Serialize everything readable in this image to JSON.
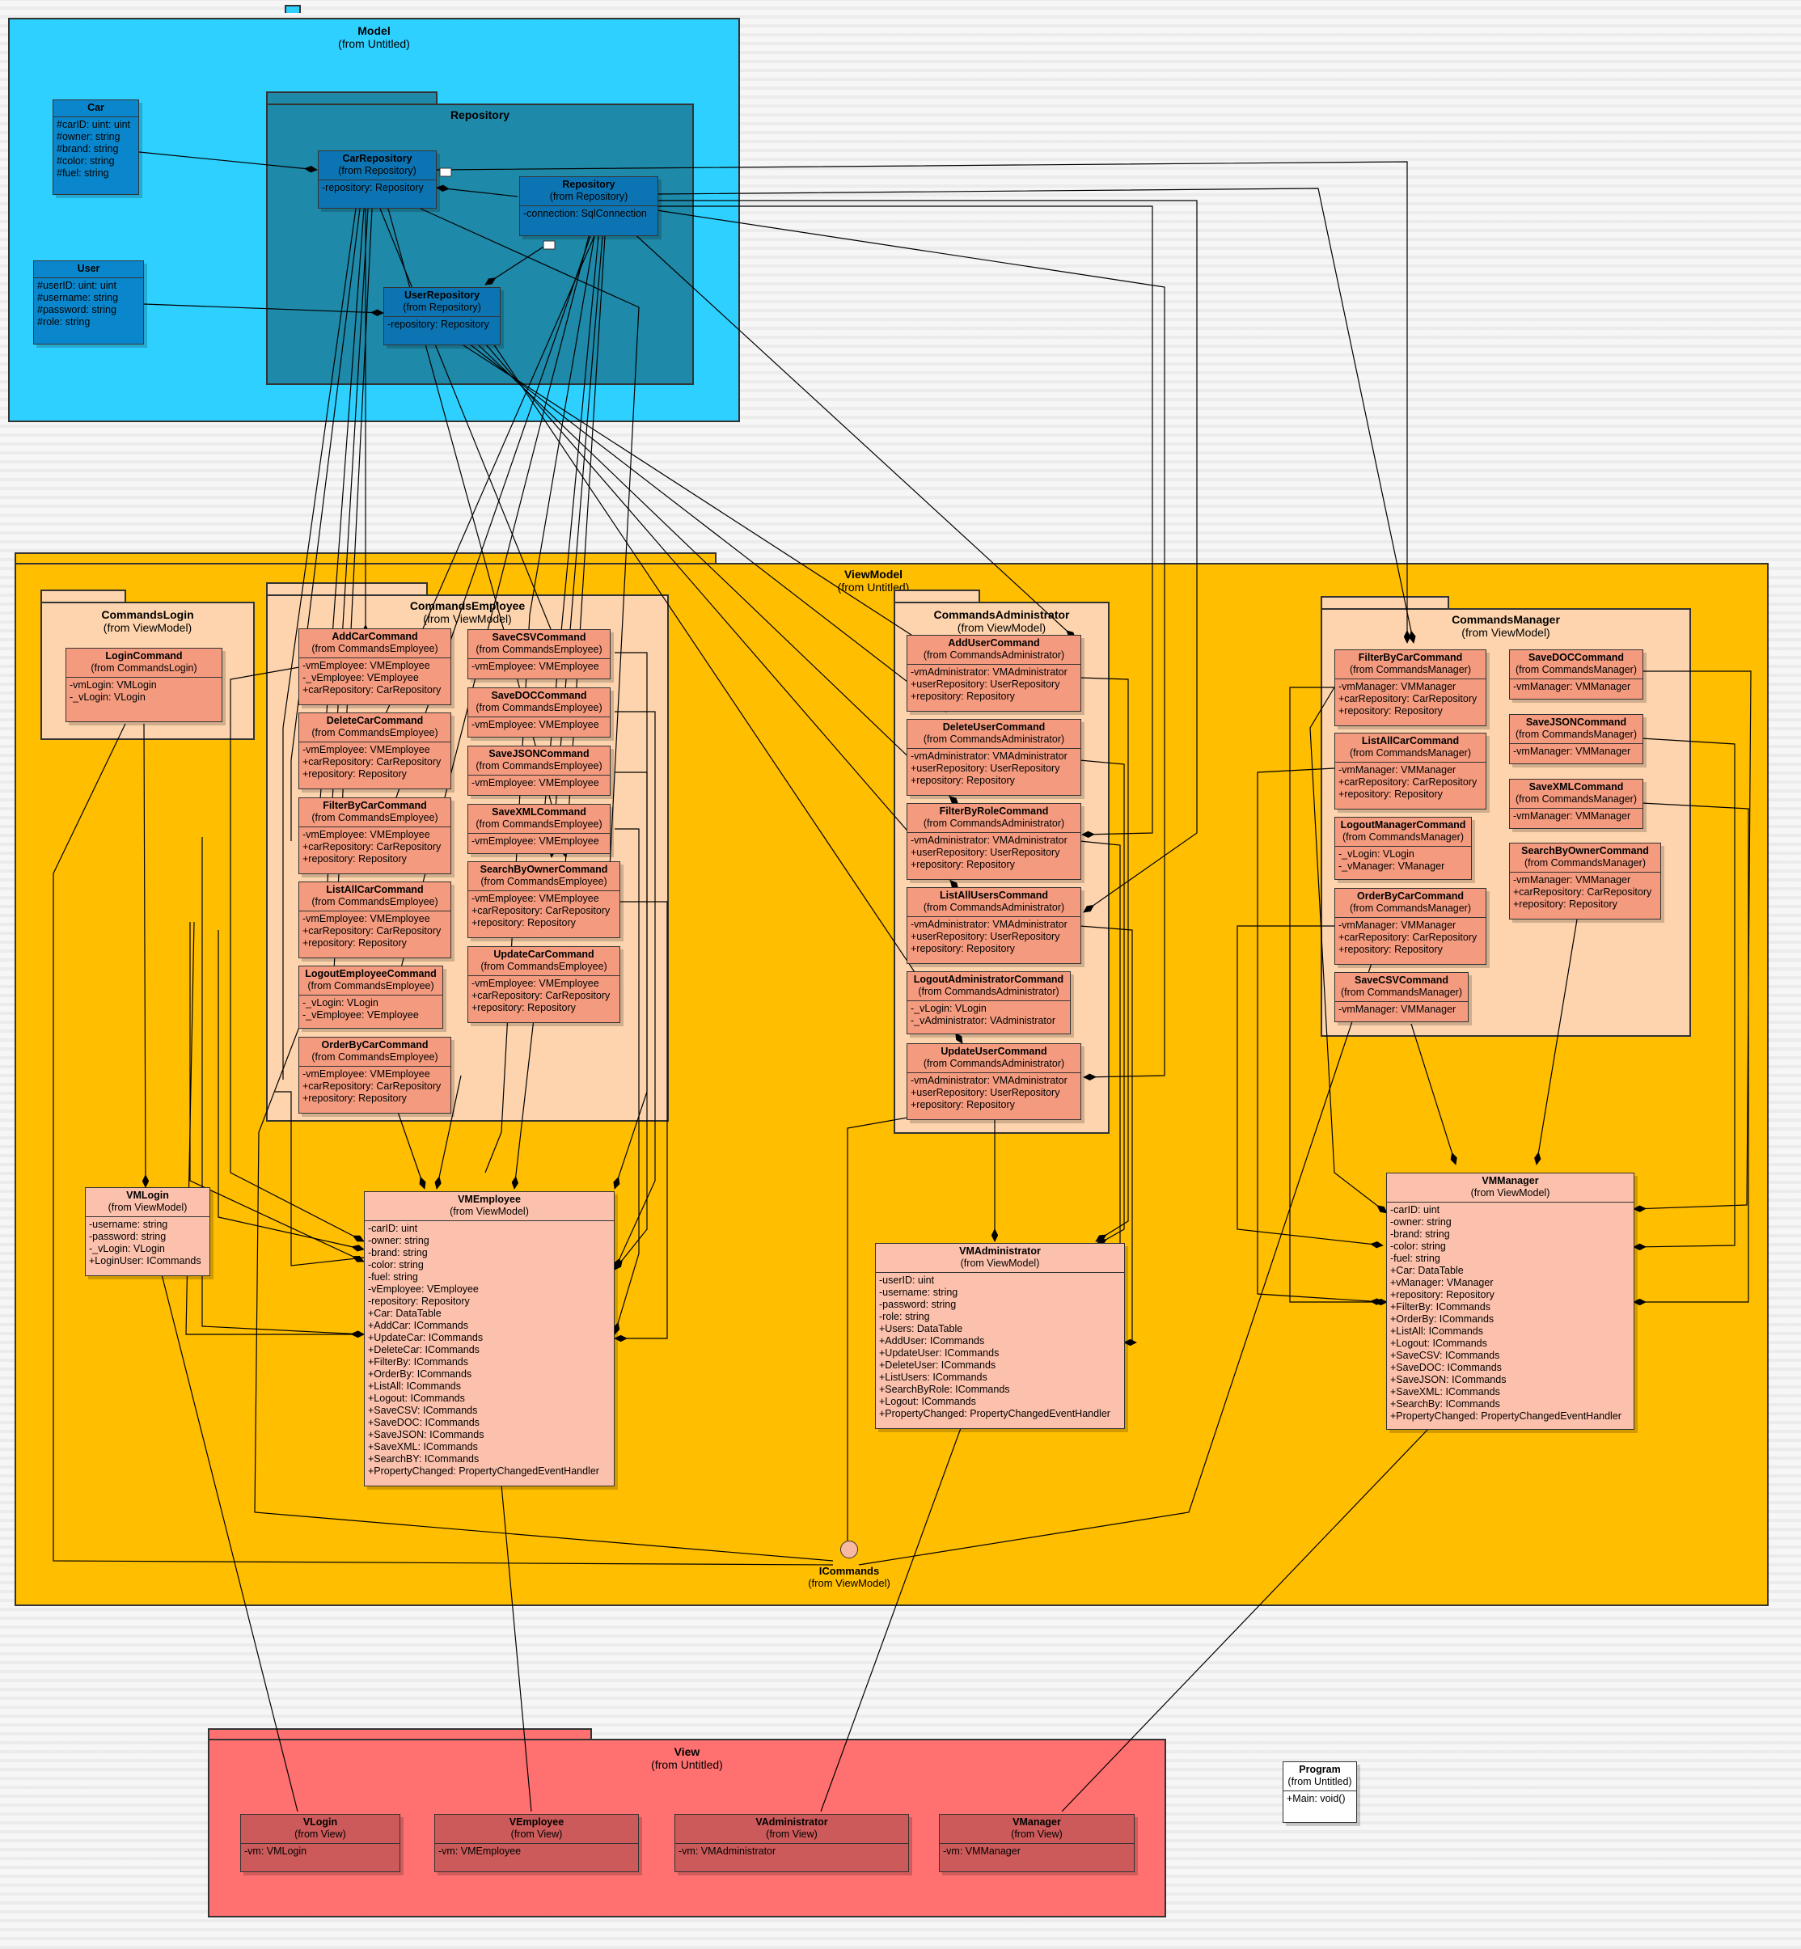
{
  "packages": {
    "model": {
      "name": "Model",
      "from": "(from Untitled)"
    },
    "repository": {
      "name": "Repository"
    },
    "viewmodel": {
      "name": "ViewModel",
      "from": "(from Untitled)"
    },
    "commands_login": {
      "name": "CommandsLogin",
      "from": "(from ViewModel)"
    },
    "commands_employee": {
      "name": "CommandsEmployee",
      "from": "(from ViewModel)"
    },
    "commands_admin": {
      "name": "CommandsAdministrator",
      "from": "(from ViewModel)"
    },
    "commands_manager": {
      "name": "CommandsManager",
      "from": "(from ViewModel)"
    },
    "view": {
      "name": "View",
      "from": "(from Untitled)"
    }
  },
  "classes": {
    "car": {
      "name": "Car",
      "attrs": [
        "#carID: uint: uint",
        "#owner: string",
        "#brand: string",
        "#color: string",
        "#fuel: string"
      ]
    },
    "user": {
      "name": "User",
      "attrs": [
        "#userID: uint: uint",
        "#username: string",
        "#password: string",
        "#role: string"
      ]
    },
    "car_repository": {
      "name": "CarRepository",
      "from": "(from Repository)",
      "attrs": [
        "-repository: Repository"
      ]
    },
    "repository": {
      "name": "Repository",
      "from": "(from Repository)",
      "attrs": [
        "-connection: SqlConnection"
      ]
    },
    "user_repository": {
      "name": "UserRepository",
      "from": "(from Repository)",
      "attrs": [
        "-repository: Repository"
      ]
    },
    "login_command": {
      "name": "LoginCommand",
      "from": "(from CommandsLogin)",
      "attrs": [
        "-vmLogin: VMLogin",
        "-_vLogin: VLogin"
      ]
    },
    "add_car_command": {
      "name": "AddCarCommand",
      "from": "(from CommandsEmployee)",
      "attrs": [
        "-vmEmployee: VMEmployee",
        "-_vEmployee: VEmployee",
        "+carRepository: CarRepository"
      ]
    },
    "delete_car_command": {
      "name": "DeleteCarCommand",
      "from": "(from CommandsEmployee)",
      "attrs": [
        "-vmEmployee: VMEmployee",
        "+carRepository: CarRepository",
        "+repository: Repository"
      ]
    },
    "filter_by_car_command_e": {
      "name": "FilterByCarCommand",
      "from": "(from CommandsEmployee)",
      "attrs": [
        "-vmEmployee: VMEmployee",
        "+carRepository: CarRepository",
        "+repository: Repository"
      ]
    },
    "list_all_car_command_e": {
      "name": "ListAllCarCommand",
      "from": "(from CommandsEmployee)",
      "attrs": [
        "-vmEmployee: VMEmployee",
        "+carRepository: CarRepository",
        "+repository: Repository"
      ]
    },
    "logout_employee_command": {
      "name": "LogoutEmployeeCommand",
      "from": "(from CommandsEmployee)",
      "attrs": [
        "-_vLogin: VLogin",
        "-_vEmployee: VEmployee"
      ]
    },
    "order_by_car_command_e": {
      "name": "OrderByCarCommand",
      "from": "(from CommandsEmployee)",
      "attrs": [
        "-vmEmployee: VMEmployee",
        "+carRepository: CarRepository",
        "+repository: Repository"
      ]
    },
    "save_csv_command_e": {
      "name": "SaveCSVCommand",
      "from": "(from CommandsEmployee)",
      "attrs": [
        "-vmEmployee: VMEmployee"
      ]
    },
    "save_doc_command_e": {
      "name": "SaveDOCCommand",
      "from": "(from CommandsEmployee)",
      "attrs": [
        "-vmEmployee: VMEmployee"
      ]
    },
    "save_json_command_e": {
      "name": "SaveJSONCommand",
      "from": "(from CommandsEmployee)",
      "attrs": [
        "-vmEmployee: VMEmployee"
      ]
    },
    "save_xml_command_e": {
      "name": "SaveXMLCommand",
      "from": "(from CommandsEmployee)",
      "attrs": [
        "-vmEmployee: VMEmployee"
      ]
    },
    "search_by_owner_command_e": {
      "name": "SearchByOwnerCommand",
      "from": "(from CommandsEmployee)",
      "attrs": [
        "-vmEmployee: VMEmployee",
        "+carRepository: CarRepository",
        "+repository: Repository"
      ]
    },
    "update_car_command": {
      "name": "UpdateCarCommand",
      "from": "(from CommandsEmployee)",
      "attrs": [
        "-vmEmployee: VMEmployee",
        "+carRepository: CarRepository",
        "+repository: Repository"
      ]
    },
    "add_user_command": {
      "name": "AddUserCommand",
      "from": "(from CommandsAdministrator)",
      "attrs": [
        "-vmAdministrator: VMAdministrator",
        "+userRepository: UserRepository",
        "+repository: Repository"
      ]
    },
    "delete_user_command": {
      "name": "DeleteUserCommand",
      "from": "(from CommandsAdministrator)",
      "attrs": [
        "-vmAdministrator: VMAdministrator",
        "+userRepository: UserRepository",
        "+repository: Repository"
      ]
    },
    "filter_by_role_command": {
      "name": "FilterByRoleCommand",
      "from": "(from CommandsAdministrator)",
      "attrs": [
        "-vmAdministrator: VMAdministrator",
        "+userRepository: UserRepository",
        "+repository: Repository"
      ]
    },
    "list_all_users_command": {
      "name": "ListAllUsersCommand",
      "from": "(from CommandsAdministrator)",
      "attrs": [
        "-vmAdministrator: VMAdministrator",
        "+userRepository: UserRepository",
        "+repository: Repository"
      ]
    },
    "logout_admin_command": {
      "name": "LogoutAdministratorCommand",
      "from": "(from CommandsAdministrator)",
      "attrs": [
        "-_vLogin: VLogin",
        "-_vAdministrator: VAdministrator"
      ]
    },
    "update_user_command": {
      "name": "UpdateUserCommand",
      "from": "(from CommandsAdministrator)",
      "attrs": [
        "-vmAdministrator: VMAdministrator",
        "+userRepository: UserRepository",
        "+repository: Repository"
      ]
    },
    "filter_by_car_command_m": {
      "name": "FilterByCarCommand",
      "from": "(from CommandsManager)",
      "attrs": [
        "-vmManager: VMManager",
        "+carRepository: CarRepository",
        "+repository: Repository"
      ]
    },
    "list_all_car_command_m": {
      "name": "ListAllCarCommand",
      "from": "(from CommandsManager)",
      "attrs": [
        "-vmManager: VMManager",
        "+carRepository: CarRepository",
        "+repository: Repository"
      ]
    },
    "logout_manager_command": {
      "name": "LogoutManagerCommand",
      "from": "(from CommandsManager)",
      "attrs": [
        "-_vLogin: VLogin",
        "-_vManager: VManager"
      ]
    },
    "order_by_car_command_m": {
      "name": "OrderByCarCommand",
      "from": "(from CommandsManager)",
      "attrs": [
        "-vmManager: VMManager",
        "+carRepository: CarRepository",
        "+repository: Repository"
      ]
    },
    "save_csv_command_m": {
      "name": "SaveCSVCommand",
      "from": "(from CommandsManager)",
      "attrs": [
        "-vmManager: VMManager"
      ]
    },
    "save_doc_command_m": {
      "name": "SaveDOCCommand",
      "from": "(from CommandsManager)",
      "attrs": [
        "-vmManager: VMManager"
      ]
    },
    "save_json_command_m": {
      "name": "SaveJSONCommand",
      "from": "(from CommandsManager)",
      "attrs": [
        "-vmManager: VMManager"
      ]
    },
    "save_xml_command_m": {
      "name": "SaveXMLCommand",
      "from": "(from CommandsManager)",
      "attrs": [
        "-vmManager: VMManager"
      ]
    },
    "search_by_owner_command_m": {
      "name": "SearchByOwnerCommand",
      "from": "(from CommandsManager)",
      "attrs": [
        "-vmManager: VMManager",
        "+carRepository: CarRepository",
        "+repository: Repository"
      ]
    },
    "vmlogin": {
      "name": "VMLogin",
      "from": "(from ViewModel)",
      "attrs": [
        "-username: string",
        "-password: string",
        "-_vLogin: VLogin",
        "+LoginUser: ICommands"
      ]
    },
    "vmemployee": {
      "name": "VMEmployee",
      "from": "(from ViewModel)",
      "attrs": [
        "-carID: uint",
        "-owner: string",
        "-brand: string",
        "-color: string",
        "-fuel: string",
        "-vEmployee: VEmployee",
        "-repository: Repository",
        "+Car: DataTable",
        "+AddCar: ICommands",
        "+UpdateCar: ICommands",
        "+DeleteCar: ICommands",
        "+FilterBy: ICommands",
        "+OrderBy: ICommands",
        "+ListAll: ICommands",
        "+Logout: ICommands",
        "+SaveCSV: ICommands",
        "+SaveDOC: ICommands",
        "+SaveJSON: ICommands",
        "+SaveXML: ICommands",
        "+SearchBY: ICommands",
        "+PropertyChanged: PropertyChangedEventHandler"
      ]
    },
    "vmadministrator": {
      "name": "VMAdministrator",
      "from": "(from ViewModel)",
      "attrs": [
        "-userID: uint",
        "-username: string",
        "-password: string",
        "-role: string",
        "+Users: DataTable",
        "+AddUser: ICommands",
        "+UpdateUser: ICommands",
        "+DeleteUser: ICommands",
        "+ListUsers: ICommands",
        "+SearchByRole: ICommands",
        "+Logout: ICommands",
        "+PropertyChanged: PropertyChangedEventHandler"
      ]
    },
    "vmmanager": {
      "name": "VMManager",
      "from": "(from ViewModel)",
      "attrs": [
        "-carID: uint",
        "-owner: string",
        "-brand: string",
        "-color: string",
        "-fuel: string",
        "+Car: DataTable",
        "+vManager: VManager",
        "+repository: Repository",
        "+FilterBy: ICommands",
        "+OrderBy: ICommands",
        "+ListAll: ICommands",
        "+Logout: ICommands",
        "+SaveCSV: ICommands",
        "+SaveDOC: ICommands",
        "+SaveJSON: ICommands",
        "+SaveXML: ICommands",
        "+SearchBy: ICommands",
        "+PropertyChanged: PropertyChangedEventHandler"
      ]
    },
    "vlogin": {
      "name": "VLogin",
      "from": "(from View)",
      "attrs": [
        "-vm: VMLogin"
      ]
    },
    "vemployee": {
      "name": "VEmployee",
      "from": "(from View)",
      "attrs": [
        "-vm: VMEmployee"
      ]
    },
    "vadministrator": {
      "name": "VAdministrator",
      "from": "(from View)",
      "attrs": [
        "-vm: VMAdministrator"
      ]
    },
    "vmanager": {
      "name": "VManager",
      "from": "(from View)",
      "attrs": [
        "-vm: VMManager"
      ]
    },
    "program": {
      "name": "Program",
      "from": "(from Untitled)",
      "attrs": [
        "+Main: void()"
      ]
    }
  },
  "interface": {
    "name": "ICommands",
    "from": "(from ViewModel)"
  },
  "colors": {
    "model_pkg": "#2ed0ff",
    "repository_pkg": "#1e89a8",
    "viewmodel_pkg": "#ffbe00",
    "subpkg": "#fdd4ad",
    "view_pkg": "#ff7070"
  }
}
